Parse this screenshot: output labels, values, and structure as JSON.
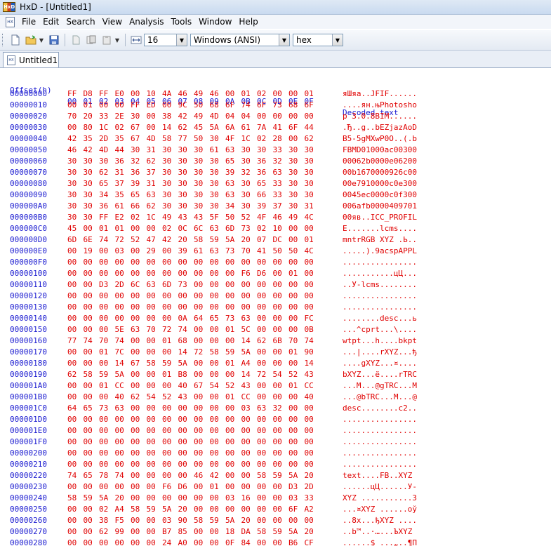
{
  "window": {
    "title": "HxD - [Untitled1]"
  },
  "menu": {
    "items": [
      "File",
      "Edit",
      "Search",
      "View",
      "Analysis",
      "Tools",
      "Window",
      "Help"
    ]
  },
  "toolbar": {
    "bytes_per_row": "16",
    "charset": "Windows (ANSI)",
    "display_mode": "hex"
  },
  "tabs": [
    {
      "label": "Untitled1"
    }
  ],
  "hex": {
    "header": {
      "offset_label": "Offset(h)",
      "columns": [
        "00",
        "01",
        "02",
        "03",
        "04",
        "05",
        "06",
        "07",
        "08",
        "09",
        "0A",
        "0B",
        "0C",
        "0D",
        "0E",
        "0F"
      ],
      "decoded_label": "Decoded text"
    },
    "rows": [
      {
        "offset": "00000000",
        "bytes": "FF D8 FF E0 00 10 4A 46 49 46 00 01 02 00 00 01",
        "text": "яШяа..JFIF......"
      },
      {
        "offset": "00000010",
        "bytes": "00 01 00 00 FF ED 00 9C 50 68 6F 74 6F 73 68 6F",
        "text": "....ян.њPhotosho"
      },
      {
        "offset": "00000020",
        "bytes": "70 20 33 2E 30 00 38 42 49 4D 04 04 00 00 00 00",
        "text": "p 3.0.8BIM......"
      },
      {
        "offset": "00000030",
        "bytes": "00 80 1C 02 67 00 14 62 45 5A 6A 61 7A 41 6F 44",
        "text": ".Ђ..g..bEZjazAoD"
      },
      {
        "offset": "00000040",
        "bytes": "42 35 2D 35 67 4D 58 77 50 30 4F 1C 02 28 00 62",
        "text": "B5-5gMXwP0O..(.b"
      },
      {
        "offset": "00000050",
        "bytes": "46 42 4D 44 30 31 30 30 30 61 63 30 30 33 30 30",
        "text": "FBMD01000ac00300"
      },
      {
        "offset": "00000060",
        "bytes": "30 30 30 36 32 62 30 30 30 30 65 30 36 32 30 30",
        "text": "00062b0000e06200"
      },
      {
        "offset": "00000070",
        "bytes": "30 30 62 31 36 37 30 30 30 30 39 32 36 63 30 30",
        "text": "00b1670000926c00"
      },
      {
        "offset": "00000080",
        "bytes": "30 30 65 37 39 31 30 30 30 30 63 30 65 33 30 30",
        "text": "00e7910000c0e300"
      },
      {
        "offset": "00000090",
        "bytes": "30 30 34 35 65 63 30 30 30 30 63 30 66 33 30 30",
        "text": "0045ec0000c0f300"
      },
      {
        "offset": "000000A0",
        "bytes": "30 30 36 61 66 62 30 30 30 30 34 30 39 37 30 31",
        "text": "006afb0000409701"
      },
      {
        "offset": "000000B0",
        "bytes": "30 30 FF E2 02 1C 49 43 43 5F 50 52 4F 46 49 4C",
        "text": "00яв..ICC_PROFIL"
      },
      {
        "offset": "000000C0",
        "bytes": "45 00 01 01 00 00 02 0C 6C 63 6D 73 02 10 00 00",
        "text": "E.......lcms...."
      },
      {
        "offset": "000000D0",
        "bytes": "6D 6E 74 72 52 47 42 20 58 59 5A 20 07 DC 00 01",
        "text": "mntrRGB XYZ .Ь.."
      },
      {
        "offset": "000000E0",
        "bytes": "00 19 00 03 00 29 00 39 61 63 73 70 41 50 50 4C",
        "text": ".....).9acspAPPL"
      },
      {
        "offset": "000000F0",
        "bytes": "00 00 00 00 00 00 00 00 00 00 00 00 00 00 00 00",
        "text": "................"
      },
      {
        "offset": "00000100",
        "bytes": "00 00 00 00 00 00 00 00 00 00 00 F6 D6 00 01 00",
        "text": "...........цЦ..."
      },
      {
        "offset": "00000110",
        "bytes": "00 00 D3 2D 6C 63 6D 73 00 00 00 00 00 00 00 00",
        "text": "..У-lcms........"
      },
      {
        "offset": "00000120",
        "bytes": "00 00 00 00 00 00 00 00 00 00 00 00 00 00 00 00",
        "text": "................"
      },
      {
        "offset": "00000130",
        "bytes": "00 00 00 00 00 00 00 00 00 00 00 00 00 00 00 00",
        "text": "................"
      },
      {
        "offset": "00000140",
        "bytes": "00 00 00 00 00 00 00 0A 64 65 73 63 00 00 00 FC",
        "text": "........desc...ь"
      },
      {
        "offset": "00000150",
        "bytes": "00 00 00 5E 63 70 72 74 00 00 01 5C 00 00 00 0B",
        "text": "...^cprt...\\...."
      },
      {
        "offset": "00000160",
        "bytes": "77 74 70 74 00 00 01 68 00 00 00 14 62 6B 70 74",
        "text": "wtpt...h....bkpt"
      },
      {
        "offset": "00000170",
        "bytes": "00 00 01 7C 00 00 00 14 72 58 59 5A 00 00 01 90",
        "text": "...|....rXYZ...ђ"
      },
      {
        "offset": "00000180",
        "bytes": "00 00 00 14 67 58 59 5A 00 00 01 A4 00 00 00 14",
        "text": "....gXYZ...¤...."
      },
      {
        "offset": "00000190",
        "bytes": "62 58 59 5A 00 00 01 B8 00 00 00 14 72 54 52 43",
        "text": "bXYZ...ё....rTRC"
      },
      {
        "offset": "000001A0",
        "bytes": "00 00 01 CC 00 00 00 40 67 54 52 43 00 00 01 CC",
        "text": "...М...@gTRC...М"
      },
      {
        "offset": "000001B0",
        "bytes": "00 00 00 40 62 54 52 43 00 00 01 CC 00 00 00 40",
        "text": "...@bTRC...М...@"
      },
      {
        "offset": "000001C0",
        "bytes": "64 65 73 63 00 00 00 00 00 00 00 03 63 32 00 00",
        "text": "desc........c2.."
      },
      {
        "offset": "000001D0",
        "bytes": "00 00 00 00 00 00 00 00 00 00 00 00 00 00 00 00",
        "text": "................"
      },
      {
        "offset": "000001E0",
        "bytes": "00 00 00 00 00 00 00 00 00 00 00 00 00 00 00 00",
        "text": "................"
      },
      {
        "offset": "000001F0",
        "bytes": "00 00 00 00 00 00 00 00 00 00 00 00 00 00 00 00",
        "text": "................"
      },
      {
        "offset": "00000200",
        "bytes": "00 00 00 00 00 00 00 00 00 00 00 00 00 00 00 00",
        "text": "................"
      },
      {
        "offset": "00000210",
        "bytes": "00 00 00 00 00 00 00 00 00 00 00 00 00 00 00 00",
        "text": "................"
      },
      {
        "offset": "00000220",
        "bytes": "74 65 78 74 00 00 00 00 46 42 00 00 58 59 5A 20",
        "text": "text....FB..XYZ "
      },
      {
        "offset": "00000230",
        "bytes": "00 00 00 00 00 00 F6 D6 00 01 00 00 00 00 D3 2D",
        "text": "......цЦ......У-"
      },
      {
        "offset": "00000240",
        "bytes": "58 59 5A 20 00 00 00 00 00 00 03 16 00 00 03 33",
        "text": "XYZ ...........3"
      },
      {
        "offset": "00000250",
        "bytes": "00 00 02 A4 58 59 5A 20 00 00 00 00 00 00 6F A2",
        "text": "...¤XYZ ......oў"
      },
      {
        "offset": "00000260",
        "bytes": "00 00 38 F5 00 00 03 90 58 59 5A 20 00 00 00 00",
        "text": "..8х...ђXYZ ...."
      },
      {
        "offset": "00000270",
        "bytes": "00 00 62 99 00 00 B7 85 00 00 18 DA 58 59 5A 20",
        "text": "..b™..·…...ЪXYZ "
      },
      {
        "offset": "00000280",
        "bytes": "00 00 00 00 00 00 24 A0 00 00 0F 84 00 00 B6 CF",
        "text": "......$ ...„..¶П"
      }
    ]
  }
}
